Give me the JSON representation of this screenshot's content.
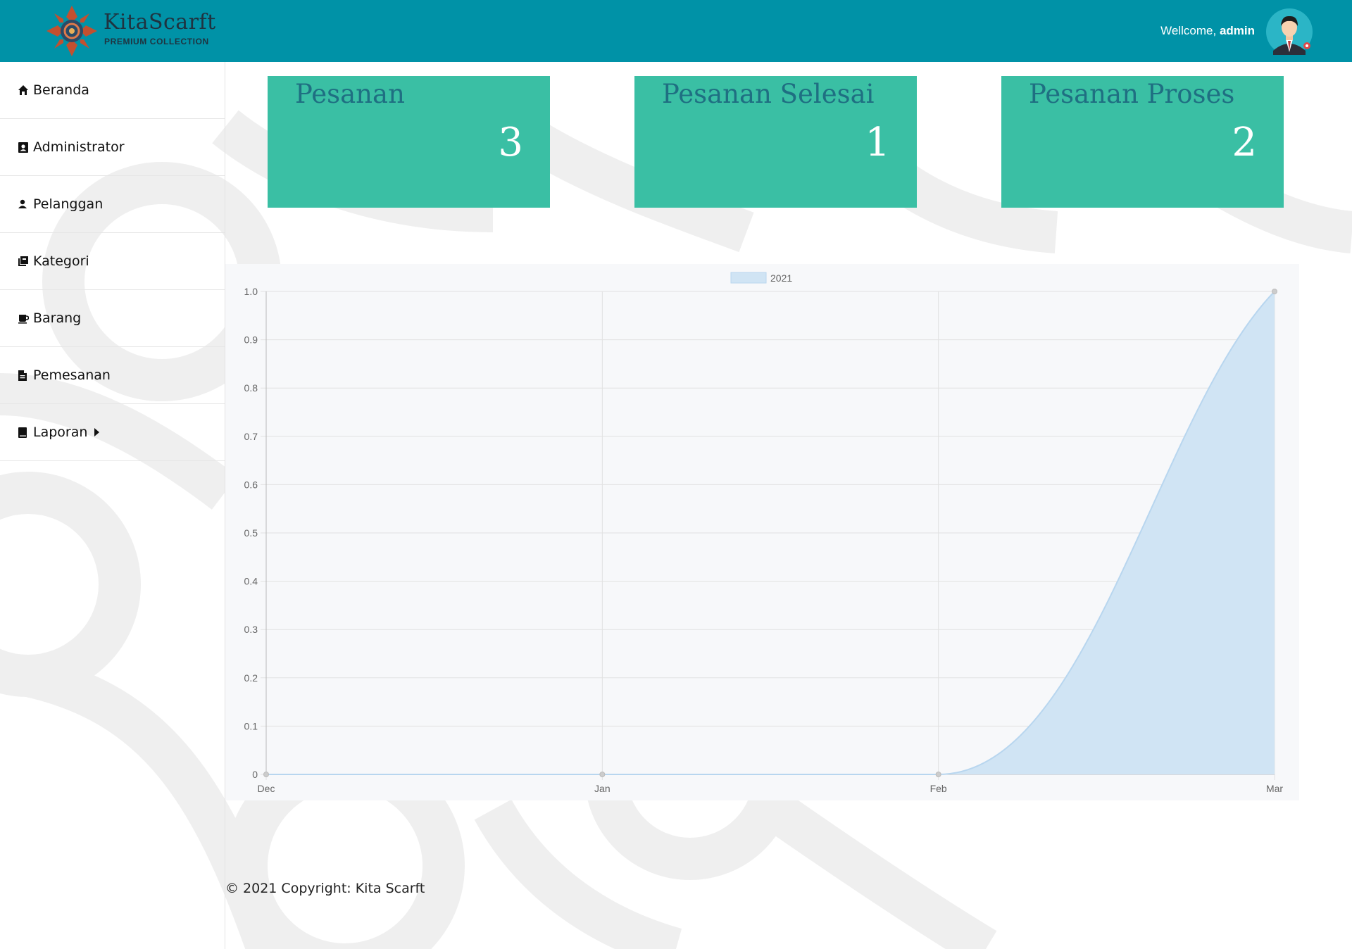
{
  "header": {
    "brand_name": "KitaScarft",
    "brand_sub": "PREMIUM COLLECTION",
    "welcome_prefix": "Wellcome, ",
    "welcome_user": "admin"
  },
  "sidebar": {
    "items": [
      {
        "label": "Beranda",
        "icon": "home-icon"
      },
      {
        "label": "Administrator",
        "icon": "contact-card-icon"
      },
      {
        "label": "Pelanggan",
        "icon": "user-icon"
      },
      {
        "label": "Kategori",
        "icon": "copy-icon"
      },
      {
        "label": "Barang",
        "icon": "coffee-icon"
      },
      {
        "label": "Pemesanan",
        "icon": "document-icon"
      },
      {
        "label": "Laporan",
        "icon": "book-icon"
      }
    ]
  },
  "cards": [
    {
      "title": "Pesanan",
      "value": "3"
    },
    {
      "title": "Pesanan Selesai",
      "value": "1"
    },
    {
      "title": "Pesanan Proses",
      "value": "2"
    }
  ],
  "colors": {
    "header": "#0092a7",
    "card": "#3abfa4",
    "card_title": "#1f6f82",
    "series_fill": "#d0e4f4",
    "series_line": "#b8d6ef"
  },
  "chart_data": {
    "type": "area",
    "x": [
      "Dec",
      "Jan",
      "Feb",
      "Mar"
    ],
    "series": [
      {
        "name": "2021",
        "values": [
          0,
          0,
          0,
          1
        ]
      }
    ],
    "ylim": [
      0,
      1.0
    ],
    "yticks": [
      "0",
      "0.1",
      "0.2",
      "0.3",
      "0.4",
      "0.5",
      "0.6",
      "0.7",
      "0.8",
      "0.9",
      "1.0"
    ],
    "grid": true,
    "legend": "top-center"
  },
  "footer": {
    "text": "© 2021 Copyright: Kita Scarft"
  }
}
